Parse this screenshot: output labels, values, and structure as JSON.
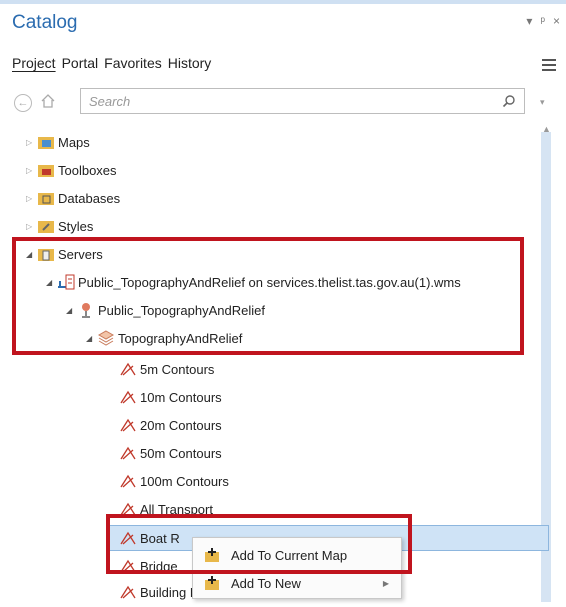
{
  "pane": {
    "title": "Catalog",
    "controls": [
      "▾",
      "ᵖ",
      "×"
    ]
  },
  "tabs": [
    "Project",
    "Portal",
    "Favorites",
    "History"
  ],
  "search": {
    "placeholder": "Search"
  },
  "tree": {
    "maps": "Maps",
    "toolboxes": "Toolboxes",
    "databases": "Databases",
    "styles": "Styles",
    "servers": "Servers",
    "server_conn": "Public_TopographyAndRelief on services.thelist.tas.gov.au(1).wms",
    "service": "Public_TopographyAndRelief",
    "group": "TopographyAndRelief",
    "layers": [
      "5m Contours",
      "10m Contours",
      "20m Contours",
      "50m Contours",
      "100m Contours",
      "All Transport",
      "Boat R",
      "Bridge",
      "Building Points"
    ]
  },
  "context_menu": {
    "items": [
      "Add To Current Map",
      "Add To New"
    ]
  },
  "colors": {
    "accent": "#2b6cb0",
    "highlight_box": "#c0141e",
    "selection": "#cfe3f6"
  }
}
